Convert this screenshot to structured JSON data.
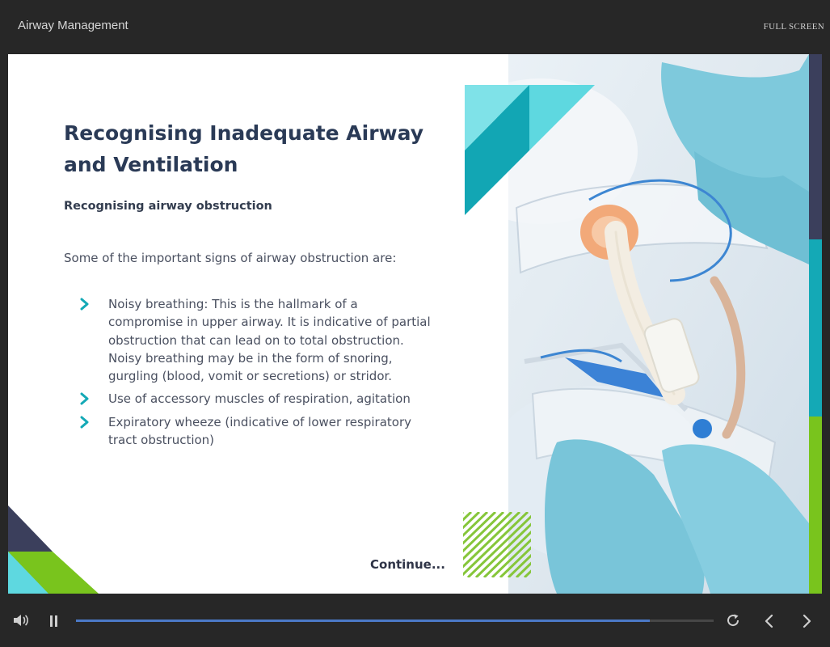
{
  "player": {
    "course_title": "Airway Management",
    "fullscreen_label": "FULL SCREEN",
    "progress_fraction": 0.9
  },
  "slide": {
    "heading": "Recognising Inadequate Airway and Ventilation",
    "subheading": "Recognising airway obstruction",
    "intro": "Some of the important signs of airway obstruction are:",
    "bullets": [
      {
        "text": "Noisy breathing: This is the hallmark of a compromise in upper airway. It is indicative of partial obstruction that can lead on to total obstruction. Noisy breathing may be in the form of snoring, gurgling (blood, vomit or secretions) or stridor."
      },
      {
        "text": "Use of accessory muscles of respiration, agitation"
      },
      {
        "text": "Expiratory wheeze (indicative of lower respiratory tract obstruction)"
      }
    ],
    "continue_label": "Continue..."
  },
  "icons": {
    "volume": "speaker-icon",
    "pause": "pause-icon",
    "replay": "replay-icon",
    "previous": "chevron-left-icon",
    "next": "chevron-right-icon",
    "bullet": "chevron-right-icon"
  },
  "colors": {
    "heading": "#2a3a56",
    "accent_teal": "#14a9b6",
    "accent_green": "#79c41d",
    "accent_navy": "#3b3f5c",
    "progress": "#4b79c7",
    "chrome": "#272727"
  }
}
